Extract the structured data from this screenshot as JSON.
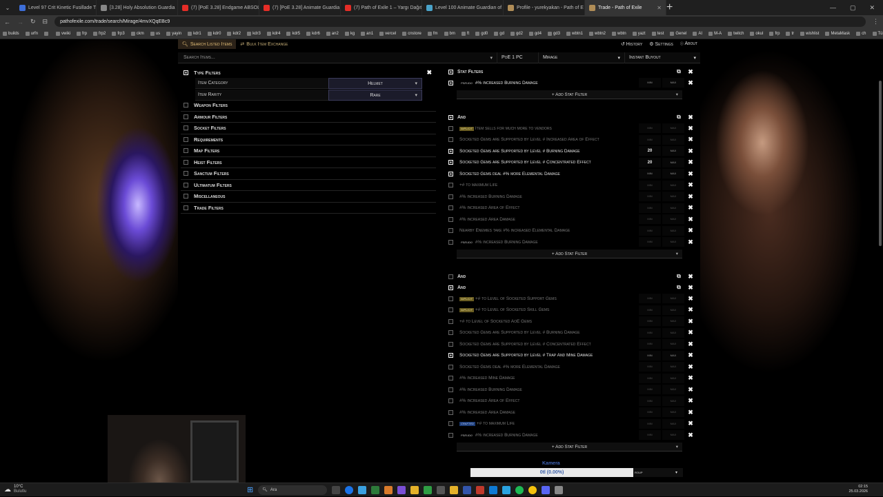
{
  "browser": {
    "tabs": [
      {
        "title": "Level 97 Crit Kinetic Fusillade T",
        "color": "#3d6ed8"
      },
      {
        "title": "[3.28] Holy Absolution Guardia",
        "color": "#888888"
      },
      {
        "title": "(7) [PoE 3.28] Endgame ABSOL",
        "color": "#e52d27"
      },
      {
        "title": "(7) [PoE 3.28] Animate Guardia",
        "color": "#e52d27"
      },
      {
        "title": "(7) Path of Exile 1 – Yargı Dağıt",
        "color": "#e52d27"
      },
      {
        "title": "Level 100 Animate Guardian of",
        "color": "#4aa3c9"
      },
      {
        "title": "Profile - yurekyakan - Path of E",
        "color": "#b08d57"
      },
      {
        "title": "Trade - Path of Exile",
        "color": "#b08d57"
      }
    ],
    "url": "pathofexile.com/trade/search/Mirage/4mvXQqEBc9",
    "bookmarks": [
      "builds",
      "urfn",
      "",
      "vwiki",
      "frp",
      "frp2",
      "frp3",
      "ckm",
      "us",
      "yayin",
      "kdr1",
      "kdr0",
      "kdr2",
      "kdr3",
      "kdr4",
      "kdr5",
      "kdr6",
      "an2",
      "kg",
      "an1",
      "vercel",
      "cnstore",
      "fm",
      "bm",
      "ft",
      "gd0",
      "gd",
      "gd2",
      "gd4",
      "gd3",
      "wbtn1",
      "wbtn2",
      "wbtn",
      "yazt",
      "test",
      "Genel",
      "AI",
      "M-A",
      "twitch",
      "okul",
      "frp",
      "tr",
      "wishlist",
      "MetaMask",
      "ch",
      "Tüm Yer İşaretleri"
    ]
  },
  "trade": {
    "nav": {
      "search": "Search Listed Items",
      "bulk": "Bulk Item Exchange",
      "history": "History",
      "settings": "Settings",
      "about": "About"
    },
    "search": {
      "placeholder": "Search Items...",
      "realm": "PoE 1 PC",
      "league": "Mirage",
      "buyout": "Instant Buyout"
    },
    "left": {
      "type_filters": "Type Filters",
      "item_category_label": "Item Category",
      "item_category_value": "Helmet",
      "item_rarity_label": "Item Rarity",
      "item_rarity_value": "Rare",
      "groups": [
        "Weapon Filters",
        "Armour Filters",
        "Socket Filters",
        "Requirements",
        "Map Filters",
        "Heist Filters",
        "Sanctum Filters",
        "Ultimatum Filters",
        "Miscellaneous",
        "Trade Filters"
      ]
    },
    "stat_filters_title": "Stat Filters",
    "and_label": "And",
    "add_stat_filter": "+ Add Stat Filter",
    "min": "min",
    "max": "max",
    "group_btn": "roup",
    "stat_group1": [
      {
        "tag": "pseudo",
        "tag_label": "pseudo",
        "text": "#% increased Burning Damage",
        "on": true,
        "min": ""
      }
    ],
    "stat_group2": [
      {
        "tag": "implicit",
        "tag_label": "implicit",
        "text": "Item sells for much more to vendors",
        "on": false,
        "min": ""
      },
      {
        "tag": "",
        "tag_label": "",
        "text": "Socketed Gems are Supported by Level # Increased Area of Effect",
        "on": false,
        "min": ""
      },
      {
        "tag": "",
        "tag_label": "",
        "text": "Socketed Gems are Supported by Level # Burning Damage",
        "on": true,
        "min": "20"
      },
      {
        "tag": "",
        "tag_label": "",
        "text": "Socketed Gems are Supported by Level # Concentrated Effect",
        "on": true,
        "min": "20"
      },
      {
        "tag": "",
        "tag_label": "",
        "text": "Socketed Gems deal #% more Elemental Damage",
        "on": true,
        "min": ""
      },
      {
        "tag": "",
        "tag_label": "",
        "text": "+# to maximum Life",
        "on": false,
        "min": ""
      },
      {
        "tag": "",
        "tag_label": "",
        "text": "#% increased Burning Damage",
        "on": false,
        "min": ""
      },
      {
        "tag": "",
        "tag_label": "",
        "text": "#% increased Area of Effect",
        "on": false,
        "min": ""
      },
      {
        "tag": "",
        "tag_label": "",
        "text": "#% increased Area Damage",
        "on": false,
        "min": ""
      },
      {
        "tag": "",
        "tag_label": "",
        "text": "Nearby Enemies take #% increased Elemental Damage",
        "on": false,
        "min": ""
      },
      {
        "tag": "pseudo",
        "tag_label": "pseudo",
        "text": "#% increased Burning Damage",
        "on": false,
        "min": ""
      }
    ],
    "stat_group4": [
      {
        "tag": "implicit",
        "tag_label": "implicit",
        "text": "+# to Level of Socketed Support Gems",
        "on": false,
        "min": ""
      },
      {
        "tag": "implicit",
        "tag_label": "implicit",
        "text": "+# to Level of Socketed Skill Gems",
        "on": false,
        "min": ""
      },
      {
        "tag": "",
        "tag_label": "",
        "text": "+# to Level of Socketed AoE Gems",
        "on": false,
        "min": ""
      },
      {
        "tag": "",
        "tag_label": "",
        "text": "Socketed Gems are Supported by Level # Burning Damage",
        "on": false,
        "min": ""
      },
      {
        "tag": "",
        "tag_label": "",
        "text": "Socketed Gems are Supported by Level # Concentrated Effect",
        "on": false,
        "min": ""
      },
      {
        "tag": "",
        "tag_label": "",
        "text": "Socketed Gems are Supported by Level # Trap And Mine Damage",
        "on": true,
        "min": ""
      },
      {
        "tag": "",
        "tag_label": "",
        "text": "Socketed Gems deal #% more Elemental Damage",
        "on": false,
        "min": ""
      },
      {
        "tag": "",
        "tag_label": "",
        "text": "#% increased Mine Damage",
        "on": false,
        "min": ""
      },
      {
        "tag": "",
        "tag_label": "",
        "text": "#% increased Burning Damage",
        "on": false,
        "min": ""
      },
      {
        "tag": "",
        "tag_label": "",
        "text": "#% increased Area of Effect",
        "on": false,
        "min": ""
      },
      {
        "tag": "",
        "tag_label": "",
        "text": "#% increased Area Damage",
        "on": false,
        "min": ""
      },
      {
        "tag": "crafted",
        "tag_label": "crafted",
        "text": "+# to maximum Life",
        "on": false,
        "min": ""
      },
      {
        "tag": "pseudo",
        "tag_label": "pseudo",
        "text": "#% increased Burning Damage",
        "on": false,
        "min": ""
      }
    ]
  },
  "overlay": {
    "kamera": "Kamera",
    "goal": "0tl (0.00%)"
  },
  "taskbar": {
    "weather_temp": "10°C",
    "weather_desc": "Bulutlu",
    "search": "Ara",
    "time": "02:15",
    "date": "25.03.2026"
  }
}
